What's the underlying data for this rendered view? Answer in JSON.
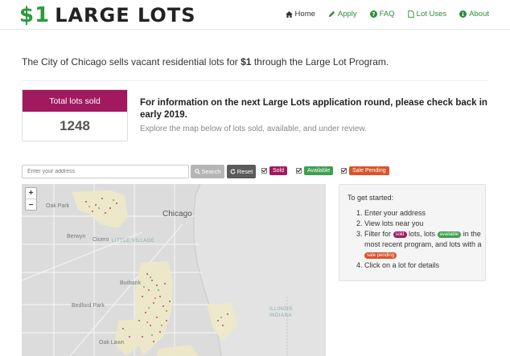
{
  "brand": {
    "dollar": "$1",
    "name": "LARGE LOTS"
  },
  "nav": {
    "items": [
      {
        "label": "Home",
        "icon": "home-icon"
      },
      {
        "label": "Apply",
        "icon": "pencil-icon"
      },
      {
        "label": "FAQ",
        "icon": "question-circle-icon"
      },
      {
        "label": "Lot Uses",
        "icon": "file-icon"
      },
      {
        "label": "About",
        "icon": "info-circle-icon"
      }
    ]
  },
  "intro": {
    "before": "The City of Chicago sells vacant residential lots for ",
    "bold": "$1",
    "after": " through the Large Lot Program."
  },
  "counter": {
    "label": "Total lots sold",
    "value": "1248"
  },
  "info": {
    "heading": "For information on the next Large Lots application round, please check back in early 2019.",
    "subtext": "Explore the map below of lots sold, available, and under review."
  },
  "search": {
    "placeholder": "Enter your address",
    "search_label": "Search",
    "reset_label": "Reset"
  },
  "filters": {
    "sold": "Sold",
    "available": "Available",
    "pending": "Sale Pending"
  },
  "map": {
    "zoom_in": "+",
    "zoom_out": "−",
    "labels": {
      "oak_park": "Oak Park",
      "chicago": "Chicago",
      "cicero": "Cicero",
      "berwyn": "Berwyn",
      "little_village": "LITTLE VILLAGE",
      "burbank": "Burbank",
      "bedford_park": "Bedford Park",
      "oak_lawn": "Oak Lawn",
      "illinois_indiana": "ILLINOIS\nINDIANA"
    }
  },
  "help": {
    "title": "To get started:",
    "step1": "Enter your address",
    "step2": "View lots near you",
    "step3_a": "Filter for ",
    "step3_sold": "sold",
    "step3_b": " lots, lots ",
    "step3_avail": "available",
    "step3_c": " in the most recent program, and lots with a ",
    "step3_pend": "sale pending",
    "step4": "Click on a lot for details"
  },
  "colors": {
    "sold": "#a1195f",
    "available": "#3f9f4e",
    "pending": "#d9542b",
    "brand_green": "#2e9a3e"
  }
}
